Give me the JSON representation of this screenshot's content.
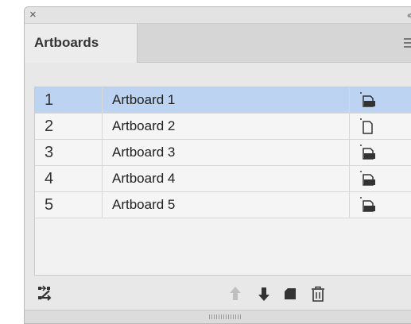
{
  "panel": {
    "close_glyph": "×",
    "collapse_glyph": "‹‹",
    "tab_label": "Artboards"
  },
  "artboards": [
    {
      "number": "1",
      "name": "Artboard 1",
      "orientation": "landscape",
      "selected": true
    },
    {
      "number": "2",
      "name": "Artboard 2",
      "orientation": "portrait",
      "selected": false
    },
    {
      "number": "3",
      "name": "Artboard 3",
      "orientation": "landscape",
      "selected": false
    },
    {
      "number": "4",
      "name": "Artboard 4",
      "orientation": "landscape",
      "selected": false
    },
    {
      "number": "5",
      "name": "Artboard 5",
      "orientation": "landscape",
      "selected": false
    }
  ],
  "toolbar": {
    "icons": [
      "rearrange-icon",
      "move-up-icon",
      "move-down-icon",
      "new-artboard-icon",
      "delete-icon"
    ],
    "move_up_enabled": false
  },
  "colors": {
    "selected_row": "#bcd3f2",
    "panel_bg": "#e8e8e8",
    "icon": "#333333",
    "disabled_icon": "#c0c0c0"
  }
}
